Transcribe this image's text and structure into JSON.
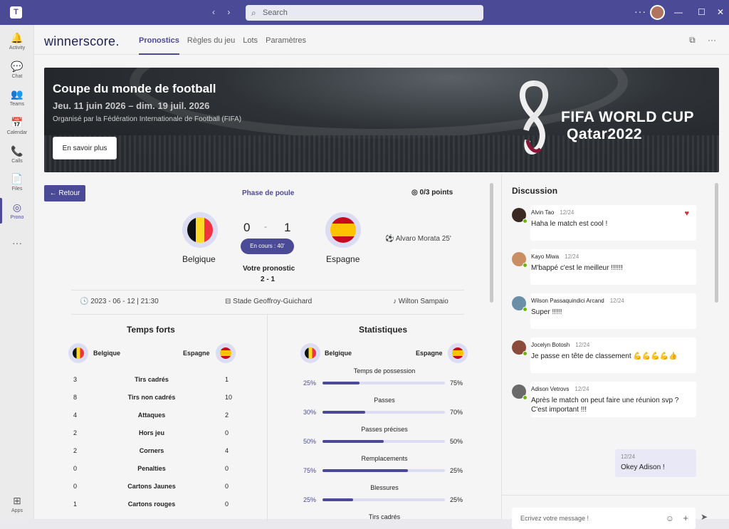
{
  "titlebar": {
    "search_placeholder": "Search",
    "nav_back": "‹",
    "nav_fwd": "›",
    "more": "···",
    "min": "—",
    "max": "☐",
    "close": "✕"
  },
  "rail": [
    {
      "label": "Activity",
      "icon": "🔔"
    },
    {
      "label": "Chat",
      "icon": "💬"
    },
    {
      "label": "Teams",
      "icon": "👥"
    },
    {
      "label": "Calendar",
      "icon": "📅"
    },
    {
      "label": "Calls",
      "icon": "📞"
    },
    {
      "label": "Files",
      "icon": "📄"
    },
    {
      "label": "Prono",
      "icon": "◎"
    },
    {
      "label": "",
      "icon": "···"
    },
    {
      "label": "Apps",
      "icon": "⊞"
    }
  ],
  "app": {
    "brand": "winnerscore.",
    "tabs": [
      "Pronostics",
      "Règles du jeu",
      "Lots",
      "Paramètres"
    ]
  },
  "banner": {
    "title": "Coupe du monde de football",
    "dates": "Jeu. 11 juin 2026 – dim. 19 juil. 2026",
    "organizer": "Organisé par la Fédération Internationale de Football (FIFA)",
    "button": "En savoir plus",
    "wc_line1": "FIFA WORLD CUP",
    "wc_line2": "Qatar2022"
  },
  "match": {
    "back": "← Retour",
    "phase": "Phase de poule",
    "points": "0/3 points",
    "home": "Belgique",
    "away": "Espagne",
    "home_score": "0",
    "away_score": "1",
    "dash": "-",
    "status": "En cours : 40'",
    "prono_label": "Votre pronostic",
    "prono_value": "2 - 1",
    "scorer": "Alvaro Morata 25'",
    "date": "2023 - 06 - 12 | 21:30",
    "stadium": "Stade Geoffroy-Guichard",
    "referee": "Wilton Sampaio"
  },
  "highlights": {
    "title": "Temps forts",
    "home": "Belgique",
    "away": "Espagne",
    "rows": [
      {
        "l": "3",
        "m": "Tirs cadrés",
        "r": "1"
      },
      {
        "l": "8",
        "m": "Tirs non cadrés",
        "r": "10"
      },
      {
        "l": "4",
        "m": "Attaques",
        "r": "2"
      },
      {
        "l": "2",
        "m": "Hors jeu",
        "r": "0"
      },
      {
        "l": "2",
        "m": "Corners",
        "r": "4"
      },
      {
        "l": "0",
        "m": "Penalties",
        "r": "0"
      },
      {
        "l": "0",
        "m": "Cartons Jaunes",
        "r": "0"
      },
      {
        "l": "1",
        "m": "Cartons rouges",
        "r": "0"
      }
    ]
  },
  "stats": {
    "title": "Statistiques",
    "home": "Belgique",
    "away": "Espagne",
    "items": [
      {
        "label": "Temps de possession",
        "l": "25%",
        "r": "75%",
        "fill": 0.3
      },
      {
        "label": "Passes",
        "l": "30%",
        "r": "70%",
        "fill": 0.35
      },
      {
        "label": "Passes précises",
        "l": "50%",
        "r": "50%",
        "fill": 0.5
      },
      {
        "label": "Remplacements",
        "l": "75%",
        "r": "25%",
        "fill": 0.7
      },
      {
        "label": "Blessures",
        "l": "25%",
        "r": "25%",
        "fill": 0.25
      },
      {
        "label": "Tirs cadrés",
        "l": "",
        "r": "",
        "fill": 0
      }
    ]
  },
  "chat": {
    "title": "Discussion",
    "messages": [
      {
        "name": "Alvin Tao",
        "time": "12/24",
        "text": "Haha le match est cool !",
        "color": "#3b2a24"
      },
      {
        "name": "Kayo Miwa",
        "time": "12/24",
        "text": "M'bappé c'est le meilleur !!!!!!",
        "color": "#c98f62"
      },
      {
        "name": "Wilson Passaquindici Arcand",
        "time": "12/24",
        "text": "Super !!!!!",
        "color": "#6b8fa8"
      },
      {
        "name": "Jocelyn Botosh",
        "time": "12/24",
        "text": "Je passe en tête de classement 💪💪💪💪👍",
        "color": "#8c4a3a"
      },
      {
        "name": "Adison Vetrovs",
        "time": "12/24",
        "text": "Après le match on peut faire une réunion svp ? C'est important !!!",
        "color": "#6a6a6a"
      }
    ],
    "mine": {
      "time": "12/24",
      "text": "Okey Adison !"
    },
    "compose_placeholder": "Ecrivez votre message !"
  }
}
